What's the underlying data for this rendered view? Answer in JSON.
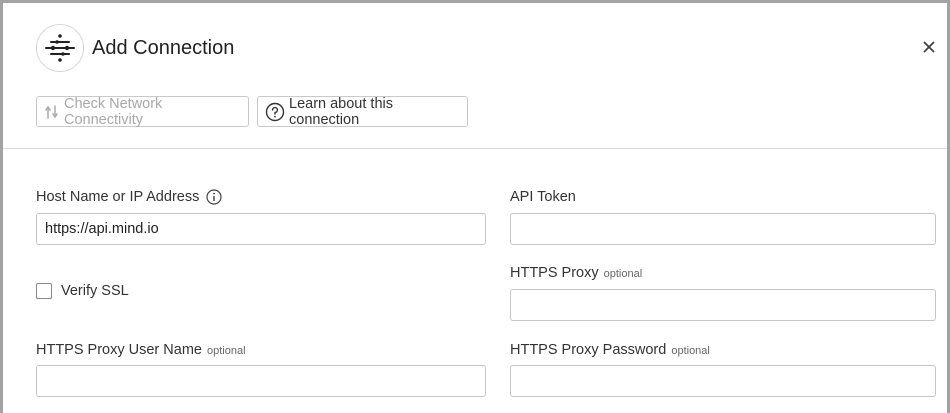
{
  "dialog": {
    "title": "Add Connection",
    "logo_icon": "connector-logo-icon",
    "close_icon": "close-icon"
  },
  "toolbar": {
    "check_label": "Check Network Connectivity",
    "learn_label": "Learn about this connection"
  },
  "form": {
    "host": {
      "label": "Host Name or IP Address",
      "value": "https://api.mind.io"
    },
    "api_token": {
      "label": "API Token",
      "value": ""
    },
    "verify_ssl": {
      "label": "Verify SSL",
      "checked": false
    },
    "https_proxy": {
      "label": "HTTPS Proxy",
      "optional": "optional",
      "value": ""
    },
    "proxy_user": {
      "label": "HTTPS Proxy User Name",
      "optional": "optional",
      "value": ""
    },
    "proxy_password": {
      "label": "HTTPS Proxy Password",
      "optional": "optional",
      "value": ""
    }
  }
}
